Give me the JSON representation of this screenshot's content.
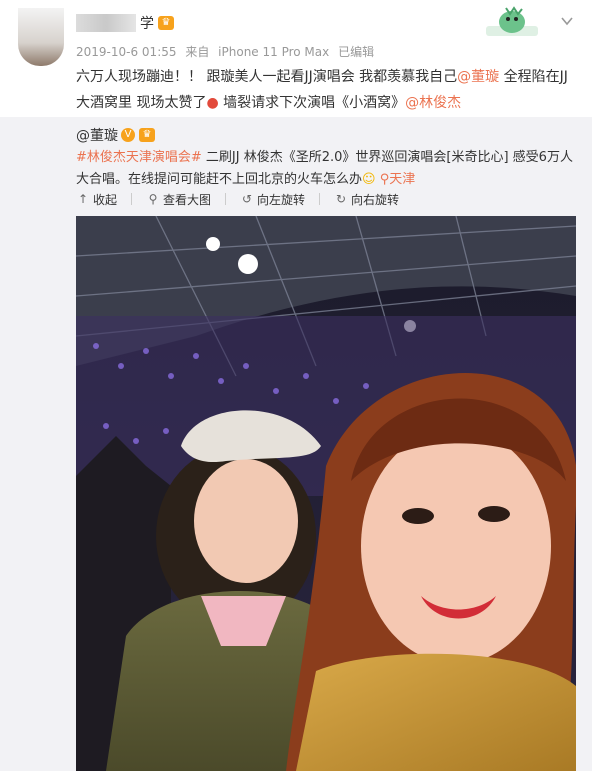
{
  "post": {
    "author_suffix": "学",
    "timestamp": "2019-10-6 01:55",
    "source_prefix": "来自",
    "source": "iPhone 11 Pro Max",
    "edited": "已编辑",
    "text_1": "六万人现场蹦迪！！ 跟璇美人一起看JJ演唱会 我都羡慕我自己",
    "mention_1": "@董璇",
    "text_2": " 全程陷在JJ大酒窝里 现场太赞了",
    "text_3": " 墙裂请求下次演唱《小酒窝》",
    "mention_2": "@林俊杰"
  },
  "repost": {
    "author": "@董璇",
    "hashtag": "#林俊杰天津演唱会#",
    "text": " 二刷JJ 林俊杰《圣所2.0》世界巡回演唱会[米奇比心] 感受6万人大合唱。在线提问可能赶不上回北京的火车怎么办",
    "location": "天津",
    "toolbar": {
      "collapse": "收起",
      "view_large": "查看大图",
      "rotate_left": "向左旋转",
      "rotate_right": "向右旋转"
    }
  },
  "icons": {
    "vip": "vip-crown-icon",
    "chevron": "chevron-down-icon",
    "location": "location-pin-icon",
    "collapse": "collapse-icon",
    "search": "magnify-icon",
    "rotate_left": "rotate-left-icon",
    "rotate_right": "rotate-right-icon"
  },
  "colors": {
    "accent": "#eb7350",
    "meta": "#999999",
    "repost_bg": "#f2f2f5"
  }
}
